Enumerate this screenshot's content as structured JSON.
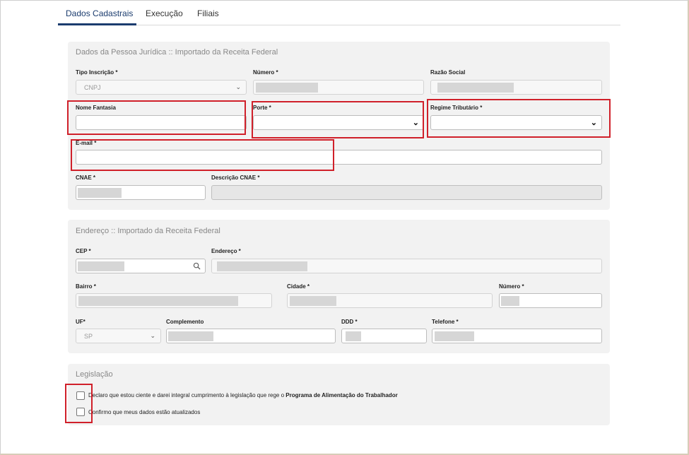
{
  "tabs": [
    {
      "label": "Dados Cadastrais"
    },
    {
      "label": "Execução"
    },
    {
      "label": "Filiais"
    }
  ],
  "pessoa_juridica": {
    "title": "Dados da Pessoa Jurídica :: Importado da Receita Federal",
    "tipo_inscricao": {
      "label": "Tipo Inscrição *",
      "value": "CNPJ"
    },
    "numero": {
      "label": "Número *"
    },
    "razao_social": {
      "label": "Razão Social"
    },
    "nome_fantasia": {
      "label": "Nome Fantasia",
      "value": ""
    },
    "porte": {
      "label": "Porte *",
      "value": ""
    },
    "regime_tributario": {
      "label": "Regime Tributário *",
      "value": ""
    },
    "email": {
      "label": "E-mail *",
      "value": ""
    },
    "cnae": {
      "label": "CNAE *"
    },
    "descricao_cnae": {
      "label": "Descrição CNAE *"
    }
  },
  "endereco": {
    "title": "Endereço :: Importado da Receita Federal",
    "cep": {
      "label": "CEP *"
    },
    "endereco": {
      "label": "Endereço *"
    },
    "bairro": {
      "label": "Bairro *"
    },
    "cidade": {
      "label": "Cidade *"
    },
    "numero": {
      "label": "Número *"
    },
    "uf": {
      "label": "UF*",
      "value": "SP"
    },
    "complemento": {
      "label": "Complemento"
    },
    "ddd": {
      "label": "DDD *"
    },
    "telefone": {
      "label": "Telefone *"
    }
  },
  "legislacao": {
    "title": "Legislação",
    "declaro_prefix": "Declaro que estou ciente e darei integral cumprimento à legislação que rege o ",
    "declaro_program": "Programa de Alimentação do Trabalhador",
    "confirmo": "Confirmo que meus dados estão atualizados"
  },
  "colors": {
    "accent": "#1b3c6e",
    "highlight": "#d0202a",
    "section_bg": "#f2f2f2"
  }
}
